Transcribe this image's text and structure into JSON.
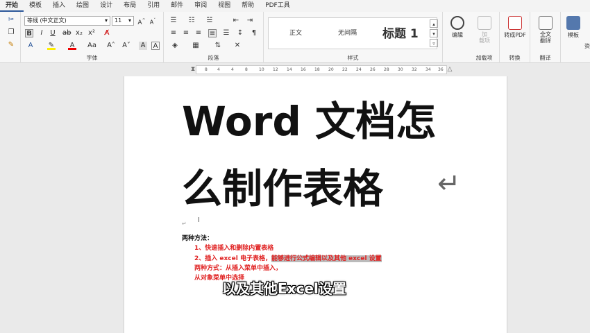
{
  "menu": [
    "开始",
    "模板",
    "插入",
    "绘图",
    "设计",
    "布局",
    "引用",
    "邮件",
    "审阅",
    "视图",
    "帮助",
    "PDF工具"
  ],
  "font": {
    "name": "等线 (中文正文)",
    "size": "11"
  },
  "groups": {
    "font": "字体",
    "paragraph": "段落",
    "styles": "样式",
    "addins": "加载项",
    "convert": "转换",
    "translate": "翻译"
  },
  "styles": {
    "normal": "正文",
    "no_spacing": "无间隔",
    "heading1": "标题 1"
  },
  "buttons": {
    "edit": "编辑",
    "addin": "加\n载项",
    "to_pdf": "转成PDF",
    "full_translate": "全文\n翻译",
    "template": "模板",
    "res": "资"
  },
  "ruler": [
    "8",
    "4",
    "4",
    "8",
    "10",
    "12",
    "14",
    "16",
    "18",
    "20",
    "22",
    "24",
    "26",
    "28",
    "30",
    "32",
    "34",
    "36",
    "38"
  ],
  "doc": {
    "title_line1": "Word 文档怎",
    "title_line2": "么制作表格",
    "heading": "两种方法：",
    "item1": "1、快速插入和删除内置表格",
    "item2a": "2、插入 excel 电子表格，",
    "item2b": "能够进行公式编辑以及其他 excel 设置",
    "item3": "两种方式：从插入菜单中插入，",
    "item4": "从对象菜单中选择"
  },
  "caption": "以及其他Excel设置"
}
